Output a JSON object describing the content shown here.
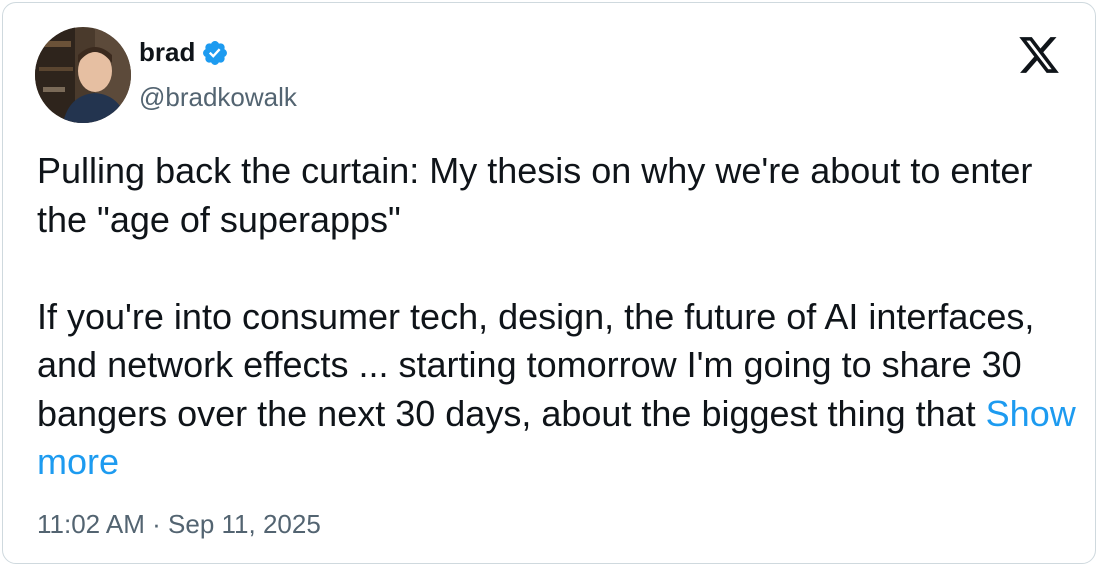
{
  "author": {
    "display_name": "brad",
    "handle": "@bradkowalk",
    "verified_icon": "verified-badge-icon",
    "avatar_icon": "profile-photo"
  },
  "brand": {
    "logo_icon": "x-logo-icon"
  },
  "tweet": {
    "paragraph_1": "Pulling back the curtain: My thesis on why we're about to enter the \"age of superapps\"",
    "paragraph_2": "If you're into consumer tech, design, the future of AI interfaces, and network effects ... starting tomorrow I'm going to share 30 bangers over the next 30 days, about the biggest thing that ",
    "show_more": "Show more"
  },
  "meta": {
    "timestamp": "11:02 AM · Sep 11, 2025"
  },
  "colors": {
    "text_primary": "#0f1419",
    "text_secondary": "#536471",
    "link": "#1d9bf0",
    "border": "#cfd9de"
  }
}
